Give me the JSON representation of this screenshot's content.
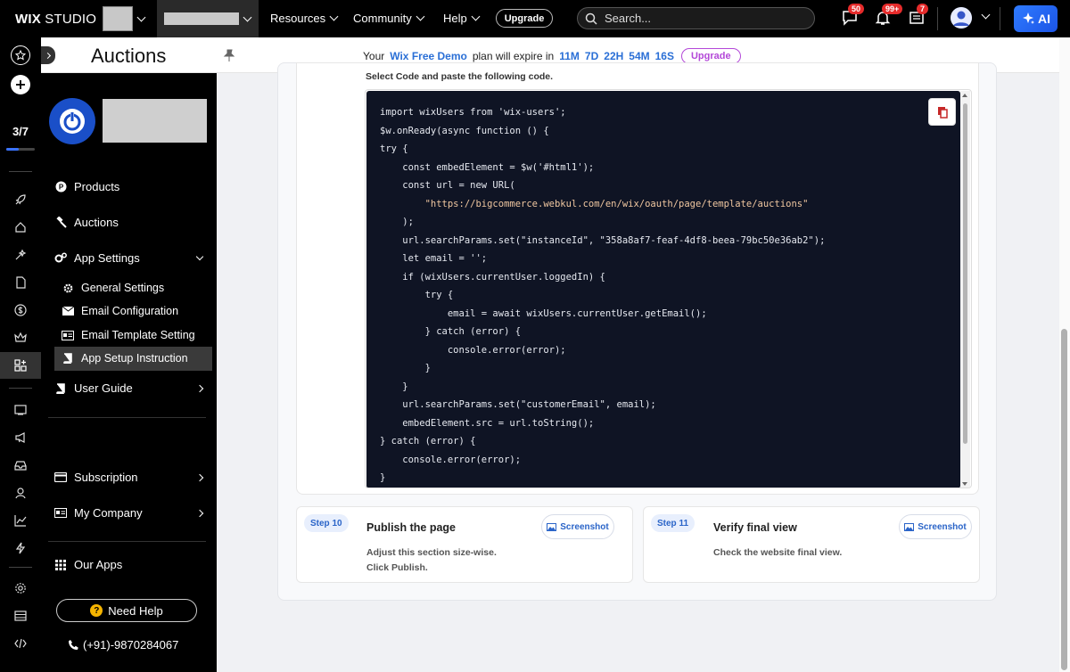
{
  "topbar": {
    "logo_bold": "WIX",
    "logo_thin": " STUDIO",
    "nav": [
      "Resources",
      "Community",
      "Help"
    ],
    "upgrade": "Upgrade",
    "search_placeholder": "Search...",
    "badges": {
      "messages": "50",
      "notifications": "99+",
      "updates": "7"
    },
    "ai_label": "AI"
  },
  "rail": {
    "progress": "3/7",
    "progress_fraction": 0.43
  },
  "app": {
    "title": "Auctions",
    "banner": {
      "prefix": "Your",
      "plan": "Wix Free Demo",
      "middle": "plan will expire in",
      "countdown": [
        "11M",
        "7D",
        "22H",
        "54M",
        "16S"
      ],
      "upgrade": "Upgrade"
    }
  },
  "sidebar": {
    "items": [
      {
        "label": "Products"
      },
      {
        "label": "Auctions"
      },
      {
        "label": "App Settings"
      }
    ],
    "sub_items": [
      {
        "label": "General Settings"
      },
      {
        "label": "Email Configuration"
      },
      {
        "label": "Email Template Setting"
      },
      {
        "label": "App Setup Instruction"
      }
    ],
    "user_guide": "User Guide",
    "subscription": "Subscription",
    "my_company": "My Company",
    "our_apps": "Our Apps",
    "need_help": "Need Help",
    "phone": "(+91)-9870284067"
  },
  "main": {
    "code_caption": "Select Code and paste the following code.",
    "code": {
      "l1": "import wixUsers from 'wix-users';",
      "l2": "$w.onReady(async function () {",
      "l3": "try {",
      "l4": "    const embedElement = $w('#html1');",
      "l5": "    const url = new URL(",
      "l6": "        \"https://bigcommerce.webkul.com/en/wix/oauth/page/template/auctions\"",
      "l7": "    );",
      "l8": "    url.searchParams.set(\"instanceId\", \"358a8af7-feaf-4df8-beea-79bc50e36ab2\");",
      "l9": "    let email = '';",
      "l10": "    if (wixUsers.currentUser.loggedIn) {",
      "l11": "        try {",
      "l12": "            email = await wixUsers.currentUser.getEmail();",
      "l13": "        } catch (error) {",
      "l14": "            console.error(error);",
      "l15": "        }",
      "l16": "    }",
      "l17": "    url.searchParams.set(\"customerEmail\", email);",
      "l18": "    embedElement.src = url.toString();",
      "l19": "} catch (error) {",
      "l20": "    console.error(error);",
      "l21": "}"
    },
    "steps": [
      {
        "badge": "Step 10",
        "title": "Publish the page",
        "desc1": "Adjust this section size-wise.",
        "desc2": "Click Publish.",
        "button": "Screenshot"
      },
      {
        "badge": "Step 11",
        "title": "Verify final view",
        "desc1": "Check the website final view.",
        "button": "Screenshot"
      }
    ]
  }
}
